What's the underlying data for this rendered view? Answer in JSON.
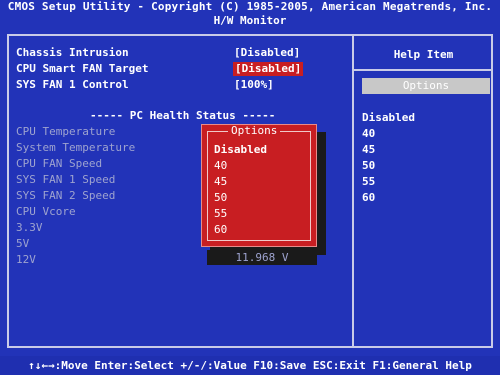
{
  "header": {
    "title": "CMOS Setup Utility - Copyright (C) 1985-2005, American Megatrends, Inc.",
    "subtitle": "H/W Monitor"
  },
  "settings": [
    {
      "label": "Chassis Intrusion",
      "value": "[Disabled]"
    },
    {
      "label": "CPU Smart FAN Target",
      "value": "[Disabled]"
    },
    {
      "label": "SYS FAN 1 Control",
      "value": "[100%]"
    }
  ],
  "health": {
    "section_title": "----- PC Health Status -----",
    "items": [
      "CPU Temperature",
      "System Temperature",
      "CPU FAN Speed",
      "SYS FAN 1 Speed",
      "SYS FAN 2 Speed",
      "CPU Vcore",
      "3.3V",
      "5V",
      "12V"
    ],
    "visible_value_12v": "11.968 V"
  },
  "help": {
    "title": "Help Item",
    "options_label": "Options",
    "options": [
      "Disabled",
      "40",
      "45",
      "50",
      "55",
      "60"
    ]
  },
  "popup": {
    "title": "Options",
    "items": [
      "Disabled",
      "40",
      "45",
      "50",
      "55",
      "60"
    ]
  },
  "footer": {
    "text": "↑↓←→:Move  Enter:Select  +/-/:Value  F10:Save  ESC:Exit  F1:General Help"
  },
  "colors": {
    "background": "#2233b8",
    "selected": "#c81e22",
    "dim_text": "#9ea3cf"
  }
}
